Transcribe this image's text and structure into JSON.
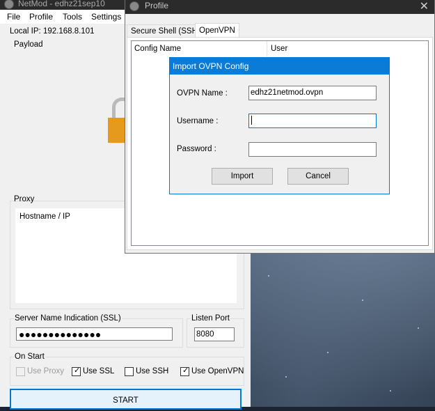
{
  "main_window": {
    "title": "NetMod - edhz21sep10",
    "menu": [
      "File",
      "Profile",
      "Tools",
      "Settings"
    ],
    "local_ip_label": "Local IP: 192.168.8.101",
    "payload_label": "Payload",
    "proxy_label": "Proxy",
    "hostname_label": "Hostname / IP",
    "sni_label": "Server Name Indication (SSL)",
    "sni_value": "●●●●●●●●●●●●●●",
    "listen_port_label": "Listen Port",
    "listen_port_value": "8080",
    "on_start_label": "On Start",
    "options": [
      {
        "label": "Use Proxy",
        "checked": false,
        "enabled": false
      },
      {
        "label": "Use SSL",
        "checked": true,
        "enabled": true
      },
      {
        "label": "Use SSH",
        "checked": false,
        "enabled": true
      },
      {
        "label": "Use OpenVPN",
        "checked": true,
        "enabled": true
      }
    ],
    "start_label": "START"
  },
  "profile_window": {
    "title": "Profile",
    "close_glyph": "✕",
    "tabs": [
      "Secure Shell (SSH)",
      "OpenVPN"
    ],
    "active_tab": "OpenVPN",
    "columns": [
      "Config Name",
      "User"
    ]
  },
  "import_dialog": {
    "title": "Import OVPN Config",
    "ovpn_name_label": "OVPN Name :",
    "ovpn_name_value": "edhz21netmod.ovpn",
    "username_label": "Username :",
    "username_value": "",
    "password_label": "Password :",
    "password_value": "",
    "import_label": "Import",
    "cancel_label": "Cancel"
  },
  "colors": {
    "accent": "#0078d7",
    "dialog_title_bg": "#0a7cd8",
    "lock_orange": "#e59a1e",
    "start_button_bg": "#e5f1fb"
  }
}
